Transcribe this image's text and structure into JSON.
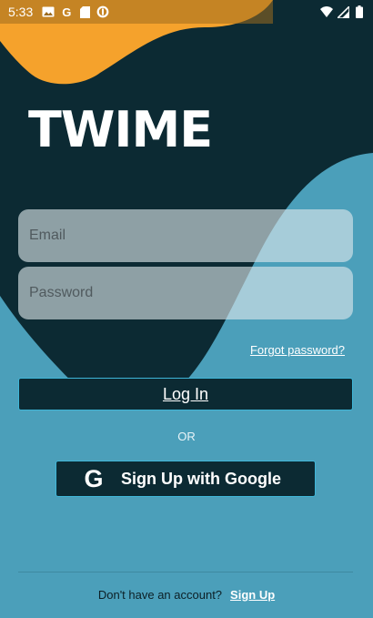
{
  "status_bar": {
    "time": "5:33",
    "left_icons": [
      "image-icon",
      "google-icon",
      "sd-card-icon",
      "data-saver-icon"
    ],
    "right_icons": [
      "wifi-icon",
      "signal-icon",
      "battery-icon"
    ]
  },
  "app": {
    "logo_text": "TWIME"
  },
  "form": {
    "email_placeholder": "Email",
    "password_placeholder": "Password",
    "forgot_password": "Forgot password?",
    "login_label": "Log In",
    "or_label": "OR",
    "google_label": "Sign Up with Google"
  },
  "footer": {
    "no_account_text": "Don't have an account?",
    "signup_link": "Sign Up"
  },
  "colors": {
    "background": "#4b9fba",
    "dark_blob": "#0c2a33",
    "orange_blob": "#f5a22c",
    "button_border": "#3fb6d8"
  }
}
